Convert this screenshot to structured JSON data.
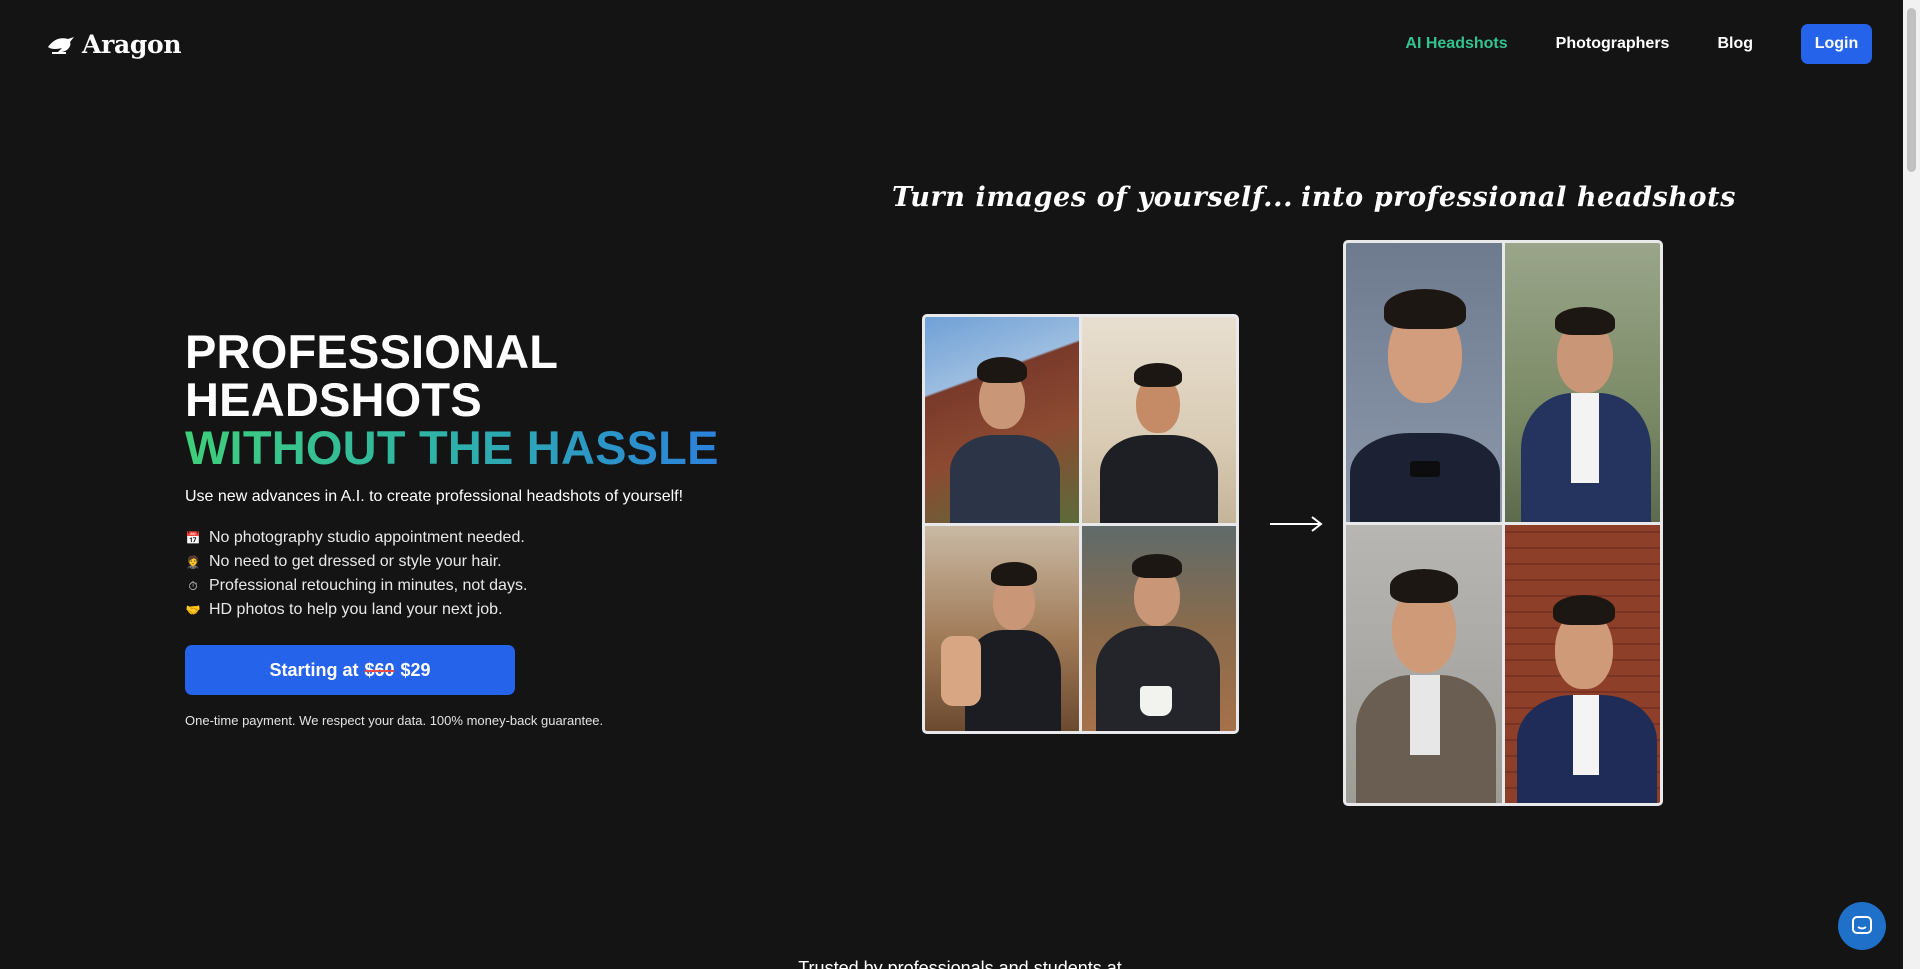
{
  "brand": {
    "name": "Aragon",
    "logo_icon": "aragon-bird-logo"
  },
  "nav": {
    "items": [
      {
        "label": "AI Headshots",
        "active": true
      },
      {
        "label": "Photographers",
        "active": false
      },
      {
        "label": "Blog",
        "active": false
      }
    ],
    "login_label": "Login"
  },
  "hero": {
    "title_line1": "PROFESSIONAL",
    "title_line2": "HEADSHOTS",
    "title_line3": "WITHOUT THE HASSLE",
    "subtitle": "Use new advances in A.I. to create professional headshots of yourself!",
    "features": [
      {
        "emoji": "📅",
        "text": "No photography studio appointment needed."
      },
      {
        "emoji": "🤵",
        "text": "No need to get dressed or style your hair."
      },
      {
        "emoji": "⏱",
        "text": "Professional retouching in minutes, not days."
      },
      {
        "emoji": "🤝",
        "text": "HD photos to help you land your next job."
      }
    ],
    "cta": {
      "prefix": "Starting at",
      "old_price": "$60",
      "price": "$29"
    },
    "guarantee": "One-time payment. We respect your data. 100% money-back guarantee."
  },
  "showcase": {
    "caption_before": "Turn images of yourself...",
    "caption_after": "into professional headshots",
    "arrow_icon": "right-arrow-icon"
  },
  "trusted_text": "Trusted by professionals and students at",
  "chat_icon": "chat-bubble-icon",
  "colors": {
    "background": "#141415",
    "accent_blue": "#2563eb",
    "active_nav": "#34c38f",
    "gradient_start": "#3ecf7a",
    "gradient_end": "#2a7de1"
  }
}
